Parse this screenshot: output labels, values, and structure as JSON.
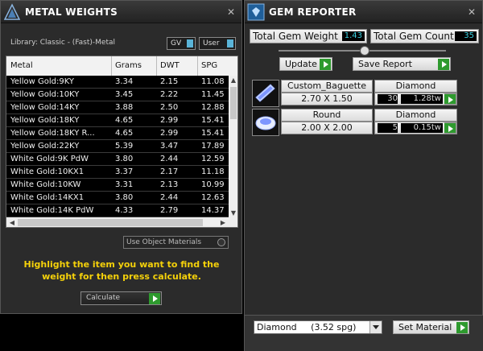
{
  "metal_weights": {
    "title": "METAL WEIGHTS",
    "library": "Library: Classic - (Fast)-Metal",
    "gv_label": "GV",
    "user_label": "User",
    "columns": [
      "Metal",
      "Grams",
      "DWT",
      "SPG"
    ],
    "rows": [
      [
        "Yellow Gold:9KY",
        "3.34",
        "2.15",
        "11.08"
      ],
      [
        "Yellow Gold:10KY",
        "3.45",
        "2.22",
        "11.45"
      ],
      [
        "Yellow Gold:14KY",
        "3.88",
        "2.50",
        "12.88"
      ],
      [
        "Yellow Gold:18KY",
        "4.65",
        "2.99",
        "15.41"
      ],
      [
        "Yellow Gold:18KY R...",
        "4.65",
        "2.99",
        "15.41"
      ],
      [
        "Yellow Gold:22KY",
        "5.39",
        "3.47",
        "17.89"
      ],
      [
        "White Gold:9K PdW",
        "3.80",
        "2.44",
        "12.59"
      ],
      [
        "White Gold:10KX1",
        "3.37",
        "2.17",
        "11.18"
      ],
      [
        "White Gold:10KW",
        "3.31",
        "2.13",
        "10.99"
      ],
      [
        "White Gold:14KX1",
        "3.80",
        "2.44",
        "12.63"
      ],
      [
        "White Gold:14K PdW",
        "4.33",
        "2.79",
        "14.37"
      ]
    ],
    "use_object_materials": "Use Object Materials",
    "hint": "Highlight the item you want to find the weight for then press calculate.",
    "calculate_label": "Calculate"
  },
  "gem_reporter": {
    "title": "GEM REPORTER",
    "total_gem_weight_label": "Total Gem Weight",
    "total_gem_weight": "1.43",
    "total_gem_count_label": "Total Gem Count",
    "total_gem_count": "35",
    "update_label": "Update",
    "save_report_label": "Save Report",
    "gems": [
      {
        "shape": "Custom_Baguette",
        "material": "Diamond",
        "size": "2.70 X 1.50",
        "count": "30",
        "weight": "1.28tw"
      },
      {
        "shape": "Round",
        "material": "Diamond",
        "size": "2.00 X 2.00",
        "count": "5",
        "weight": "0.15tw"
      }
    ],
    "material_select": "Diamond     (3.52 spg)",
    "set_material_label": "Set Material"
  },
  "colors": {
    "accent": "#3bd0e0",
    "go": "#2e9a2e",
    "hint": "#f5d10a"
  }
}
